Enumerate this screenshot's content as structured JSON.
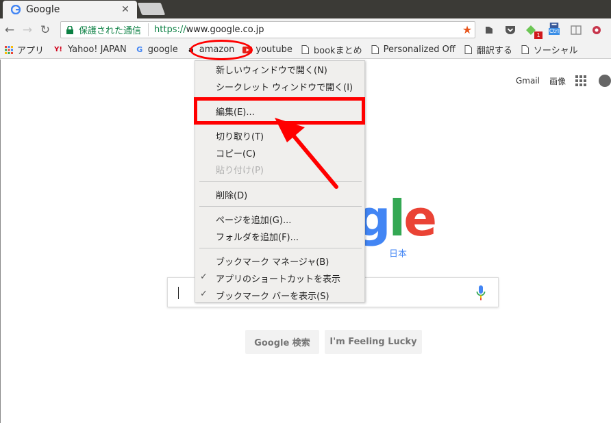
{
  "tab": {
    "title": "Google",
    "close": "✕"
  },
  "toolbar": {
    "back": "←",
    "forward": "→",
    "reload": "↻",
    "secure_label": "保護された通信",
    "url_scheme": "https://",
    "url_rest": "www.google.co.jp",
    "star": "★",
    "ext_badge": "1",
    "ext_ctrl": "Ctrl"
  },
  "bookmarks": [
    {
      "label": "アプリ",
      "icon": "apps-grid-icon"
    },
    {
      "label": "Yahoo! JAPAN",
      "icon": "yahoo-icon",
      "glyph": "Y!"
    },
    {
      "label": "google",
      "icon": "google-icon",
      "glyph": "G"
    },
    {
      "label": "amazon",
      "icon": "amazon-icon",
      "glyph": "a"
    },
    {
      "label": "youtube",
      "icon": "youtube-icon"
    },
    {
      "label": "bookまとめ",
      "icon": "page-icon"
    },
    {
      "label": "Personalized Off",
      "icon": "page-icon"
    },
    {
      "label": "翻訳する",
      "icon": "page-icon"
    },
    {
      "label": "ソーシャル",
      "icon": "page-icon"
    }
  ],
  "page": {
    "gmail": "Gmail",
    "images": "画像",
    "logo_g": "g",
    "logo_l": "l",
    "logo_e": "e",
    "logo_sub": "日本",
    "search_button": "Google 検索",
    "lucky_button": "I'm Feeling Lucky"
  },
  "context_menu": {
    "items": [
      {
        "label": "新しいウィンドウで開く(N)"
      },
      {
        "label": "シークレット ウィンドウで開く(I)"
      },
      {
        "label": "編集(E)..."
      },
      {
        "label": "切り取り(T)"
      },
      {
        "label": "コピー(C)"
      },
      {
        "label": "貼り付け(P)",
        "disabled": true
      },
      {
        "label": "削除(D)"
      },
      {
        "label": "ページを追加(G)..."
      },
      {
        "label": "フォルダを追加(F)..."
      },
      {
        "label": "ブックマーク マネージャ(B)"
      },
      {
        "label": "アプリのショートカットを表示",
        "checked": true
      },
      {
        "label": "ブックマーク バーを表示(S)",
        "checked": true
      }
    ],
    "check_glyph": "✓"
  },
  "colors": {
    "annotation_red": "#ff0000",
    "secure_green": "#0b8043",
    "google_blue": "#4285f4",
    "google_green": "#34a853",
    "google_red": "#ea4335"
  }
}
